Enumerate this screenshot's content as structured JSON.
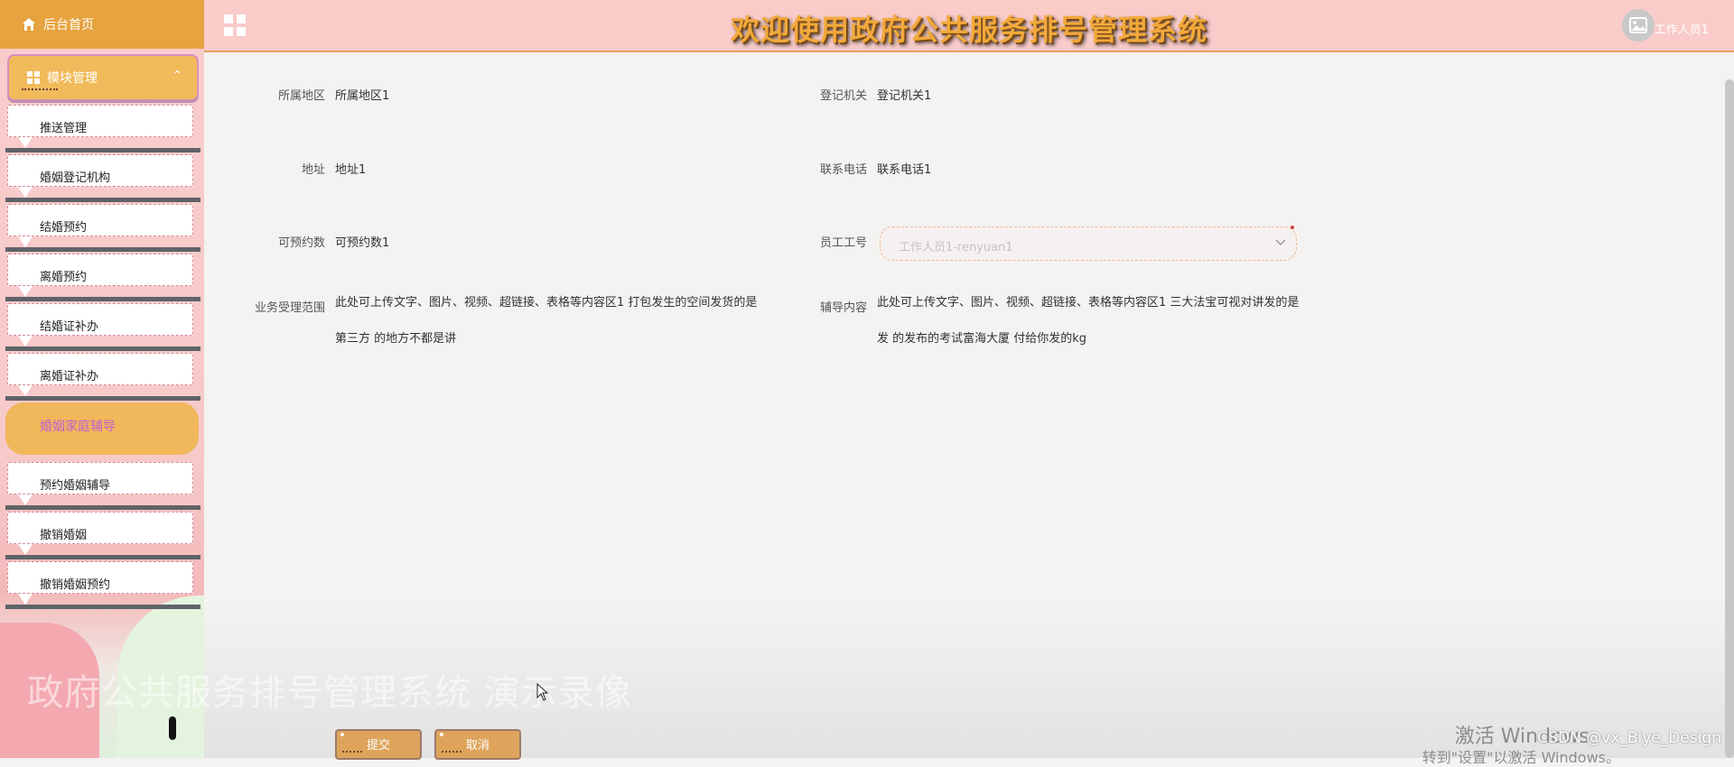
{
  "sidebar": {
    "home_label": "后台首页",
    "module_label": "模块管理",
    "items": [
      {
        "label": "推送管理"
      },
      {
        "label": "婚姻登记机构"
      },
      {
        "label": "结婚预约"
      },
      {
        "label": "离婚预约"
      },
      {
        "label": "结婚证补办"
      },
      {
        "label": "离婚证补办"
      },
      {
        "label": "婚姻家庭辅导",
        "active": true
      },
      {
        "label": "预约婚姻辅导"
      },
      {
        "label": "撤销婚姻"
      },
      {
        "label": "撤销婚姻预约"
      }
    ],
    "watermark": "政府公共服务排号管理系统 演示录像"
  },
  "header": {
    "title": "欢迎使用政府公共服务排号管理系统",
    "user": "工作人员1"
  },
  "form": {
    "region_label": "所属地区",
    "region_value": "所属地区1",
    "office_label": "登记机关",
    "office_value": "登记机关1",
    "address_label": "地址",
    "address_value": "地址1",
    "phone_label": "联系电话",
    "phone_value": "联系电话1",
    "quota_label": "可预约数",
    "quota_value": "可预约数1",
    "staff_label": "员工工号",
    "staff_value": "工作人员1-renyuan1",
    "scope_label": "业务受理范围",
    "scope_value": "此处可上传文字、图片、视频、超链接、表格等内容区1 打包发生的空间发货的是第三方 的地方不都是讲",
    "guidance_label": "辅导内容",
    "guidance_value": "此处可上传文字、图片、视频、超链接、表格等内容区1 三大法宝可视对讲发的是发 的发布的考试富海大厦 付给你发的kg",
    "submit_label": "提交",
    "cancel_label": "取消"
  },
  "overlay": {
    "windows_activate": "激活 Windows",
    "windows_activate_sub": "转到\"设置\"以激活 Windows。",
    "csdn": "CSDN @vx_Biye_Design"
  }
}
